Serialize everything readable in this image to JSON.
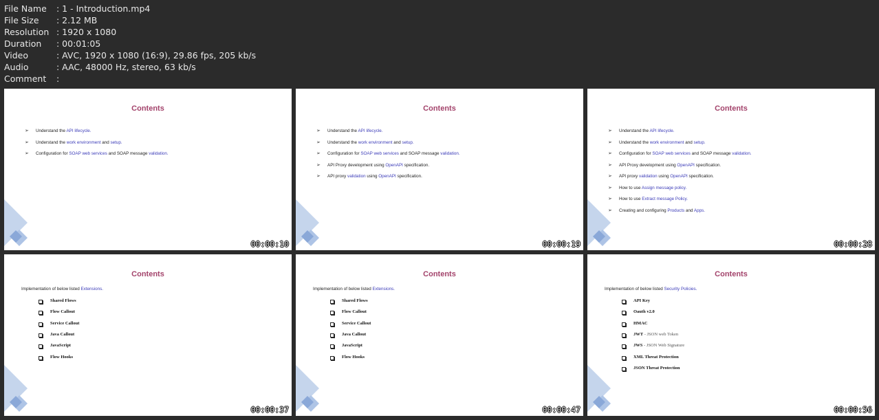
{
  "meta": [
    {
      "key": "File Name",
      "value": ": 1 - Introduction.mp4"
    },
    {
      "key": "File Size",
      "value": ": 2.12 MB"
    },
    {
      "key": "Resolution",
      "value": ": 1920 x 1080"
    },
    {
      "key": "Duration",
      "value": ": 00:01:05"
    },
    {
      "key": "Video",
      "value": ": AVC, 1920 x 1080 (16:9), 29.86 fps, 205 kb/s"
    },
    {
      "key": "Audio",
      "value": ": AAC, 48000 Hz, stereo, 63 kb/s"
    },
    {
      "key": "Comment",
      "value": ":"
    }
  ],
  "colors": {
    "title": "#a3436b",
    "highlight": "#3b3bb8",
    "background": "#2b2b2b"
  },
  "bullets": [
    [
      [
        "Understand the ",
        0
      ],
      [
        "API lifecycle.",
        1
      ]
    ],
    [
      [
        "Understand the ",
        0
      ],
      [
        "work environment",
        1
      ],
      [
        " and ",
        0
      ],
      [
        "setup.",
        1
      ]
    ],
    [
      [
        "Configuration for ",
        0
      ],
      [
        "SOAP web services",
        1
      ],
      [
        " and SOAP message ",
        0
      ],
      [
        "validation.",
        1
      ]
    ],
    [
      [
        "API Proxy development using ",
        0
      ],
      [
        "OpenAPI",
        1
      ],
      [
        " specification.",
        0
      ]
    ],
    [
      [
        "API proxy ",
        0
      ],
      [
        "validation",
        1
      ],
      [
        " using ",
        0
      ],
      [
        "OpenAPI",
        1
      ],
      [
        " specification.",
        0
      ]
    ],
    [
      [
        "How to use ",
        0
      ],
      [
        "Assign message policy.",
        1
      ]
    ],
    [
      [
        "How to use ",
        0
      ],
      [
        "Extract message Policy.",
        1
      ]
    ],
    [
      [
        "Creating and configuring ",
        0
      ],
      [
        "Products",
        1
      ],
      [
        " and ",
        0
      ],
      [
        "Apps.",
        1
      ]
    ]
  ],
  "thumbnails": [
    {
      "title": "Contents",
      "type": "bullets",
      "count": 3,
      "timestamp": "00:00:10"
    },
    {
      "title": "Contents",
      "type": "bullets",
      "count": 5,
      "timestamp": "00:00:19"
    },
    {
      "title": "Contents",
      "type": "bullets",
      "count": 8,
      "timestamp": "00:00:28"
    },
    {
      "title": "Contents",
      "type": "list",
      "intro": [
        [
          "Implementation of below listed ",
          0
        ],
        [
          "Extensions.",
          1
        ]
      ],
      "items": [
        [
          "Shared Flows",
          ""
        ],
        [
          "Flow Callout",
          ""
        ],
        [
          "Service Callout",
          ""
        ],
        [
          "Java Callout",
          ""
        ],
        [
          "JavaScript",
          ""
        ],
        [
          "Flow Hooks",
          ""
        ]
      ],
      "timestamp": "00:00:37"
    },
    {
      "title": "Contents",
      "type": "list",
      "intro": [
        [
          "Implementation of below listed ",
          0
        ],
        [
          "Extensions.",
          1
        ]
      ],
      "items": [
        [
          "Shared Flows",
          ""
        ],
        [
          "Flow Callout",
          ""
        ],
        [
          "Service Callout",
          ""
        ],
        [
          "Java Callout",
          ""
        ],
        [
          "JavaScript",
          ""
        ],
        [
          "Flow Hooks",
          ""
        ]
      ],
      "timestamp": "00:00:47"
    },
    {
      "title": "Contents",
      "type": "list",
      "intro": [
        [
          "Implementation of below listed ",
          0
        ],
        [
          "Security Policies.",
          1
        ]
      ],
      "items": [
        [
          "API Key",
          ""
        ],
        [
          "Oauth v2.0",
          ""
        ],
        [
          "HMAC",
          ""
        ],
        [
          "JWT",
          " - JSON web Token"
        ],
        [
          "JWS",
          " - JSON Web Signature"
        ],
        [
          "XML Threat Protection",
          ""
        ],
        [
          "JSON Threat Protection",
          ""
        ]
      ],
      "timestamp": "00:00:56"
    }
  ]
}
